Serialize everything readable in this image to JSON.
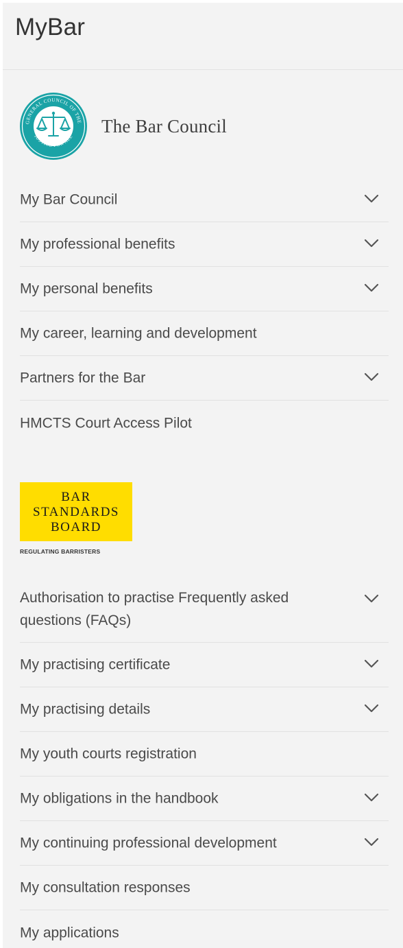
{
  "app": {
    "title": "MyBar"
  },
  "bar_council": {
    "name": "The Bar Council",
    "seal_text": {
      "ring_top": "THE GENERAL COUNCIL OF THE BAR",
      "ring_bottom": "JUSTICE FOR ALL"
    },
    "menu": [
      {
        "label": "My Bar Council",
        "expandable": true
      },
      {
        "label": "My professional benefits",
        "expandable": true
      },
      {
        "label": "My personal benefits",
        "expandable": true
      },
      {
        "label": "My career, learning and development",
        "expandable": false
      },
      {
        "label": "Partners for the Bar",
        "expandable": true
      },
      {
        "label": "HMCTS Court Access Pilot",
        "expandable": false
      }
    ]
  },
  "bsb": {
    "logo_lines": [
      "BAR",
      "STANDARDS",
      "BOARD"
    ],
    "tagline": "REGULATING BARRISTERS",
    "menu": [
      {
        "label": "Authorisation to practise Frequently asked questions (FAQs)",
        "expandable": true
      },
      {
        "label": "My practising certificate",
        "expandable": true
      },
      {
        "label": "My practising details",
        "expandable": true
      },
      {
        "label": "My youth courts registration",
        "expandable": false
      },
      {
        "label": "My obligations in the handbook",
        "expandable": true
      },
      {
        "label": "My continuing professional development",
        "expandable": true
      },
      {
        "label": "My consultation responses",
        "expandable": false
      },
      {
        "label": "My applications",
        "expandable": false
      }
    ]
  },
  "colors": {
    "panel_background": "#f3f3f3",
    "seal_teal": "#1aa3a6",
    "bsb_yellow": "#ffdd00",
    "text": "#4a4a4a"
  },
  "icons": {
    "expand": "chevron-down-icon",
    "seal": "bar-council-seal-icon"
  }
}
